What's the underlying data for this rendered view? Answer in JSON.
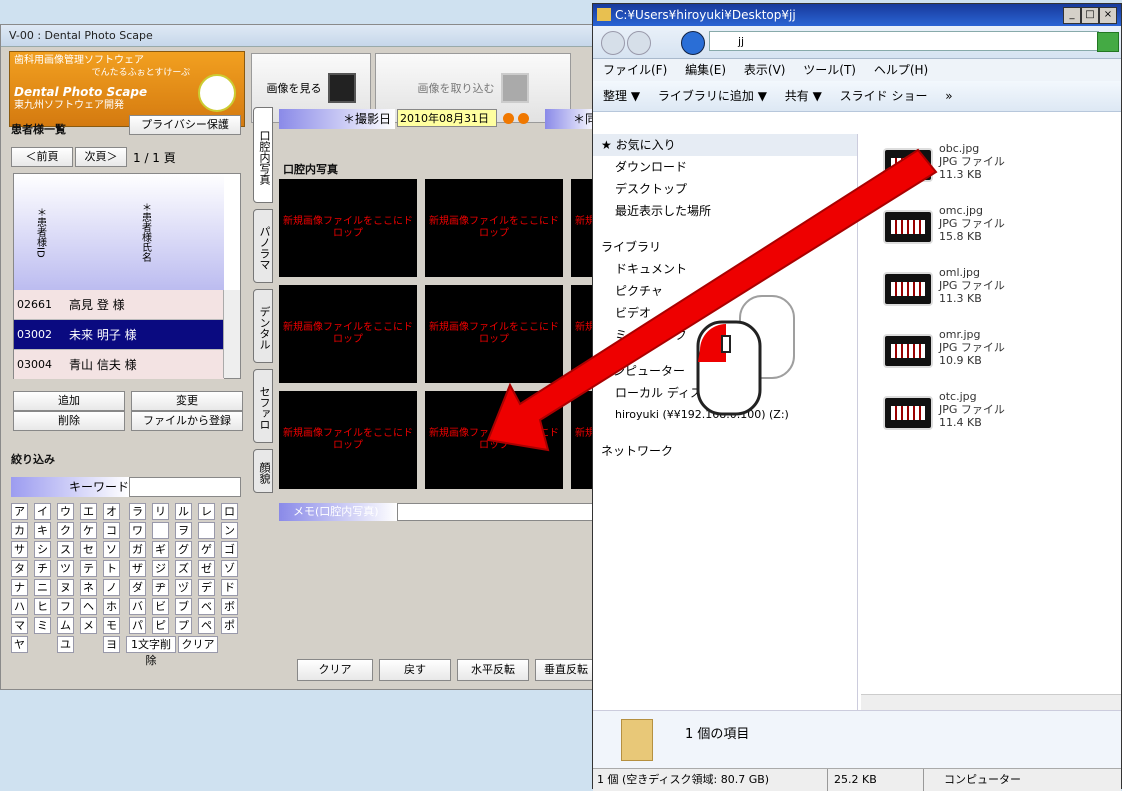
{
  "app": {
    "title": "V-00 : Dental Photo Scape",
    "logo": {
      "line1": "歯科用画像管理ソフトウェア",
      "line2": "でんたるふぉとすけーぷ",
      "brand": "Dental Photo Scape",
      "maker": "東九州ソフトウェア開発"
    },
    "toolbar": {
      "view": "画像を見る",
      "import": "画像を取り込む"
    },
    "patients": {
      "heading": "患者様一覧",
      "privacy": "プライバシー保護",
      "prev": "＜前頁",
      "next": "次頁＞",
      "page": "1 / 1 頁",
      "col_id": "＊患者様ID",
      "col_name": "＊患者様氏名",
      "rows": [
        {
          "id": "02661",
          "name": "高見 登 様"
        },
        {
          "id": "03002",
          "name": "未来 明子 様"
        },
        {
          "id": "03004",
          "name": "青山 信夫 様"
        }
      ],
      "add": "追加",
      "change": "変更",
      "delete": "削除",
      "from_file": "ファイルから登録"
    },
    "filter": {
      "heading": "絞り込み",
      "keyword_label": "キーワード",
      "kana": [
        "ア",
        "イ",
        "ウ",
        "エ",
        "オ",
        "ラ",
        "リ",
        "ル",
        "レ",
        "ロ",
        "カ",
        "キ",
        "ク",
        "ケ",
        "コ",
        "ワ",
        "",
        "ヲ",
        "",
        "ン",
        "サ",
        "シ",
        "ス",
        "セ",
        "ソ",
        "ガ",
        "ギ",
        "グ",
        "ゲ",
        "ゴ",
        "タ",
        "チ",
        "ツ",
        "テ",
        "ト",
        "ザ",
        "ジ",
        "ズ",
        "ゼ",
        "ゾ",
        "ナ",
        "ニ",
        "ヌ",
        "ネ",
        "ノ",
        "ダ",
        "ヂ",
        "ヅ",
        "デ",
        "ド",
        "ハ",
        "ヒ",
        "フ",
        "ヘ",
        "ホ",
        "バ",
        "ビ",
        "ブ",
        "ベ",
        "ボ",
        "マ",
        "ミ",
        "ム",
        "メ",
        "モ",
        "パ",
        "ピ",
        "プ",
        "ペ",
        "ポ"
      ],
      "ya": "ヤ",
      "yu": "ユ",
      "yo": "ヨ",
      "del1": "1文字削除",
      "clear": "クリア"
    },
    "tabs": [
      "口腔内写真",
      "パノラマ",
      "デンタル",
      "セファロ",
      "顔貌"
    ],
    "date_label": "＊撮影日",
    "date": "2010年08月31日",
    "date_label2": "＊同",
    "section": "口腔内写真",
    "drop_text": "新規画像ファイルをここにドロップ",
    "memo_label": "メモ(口腔内写真)",
    "bottom": {
      "clear": "クリア",
      "back": "戻す",
      "hflip": "水平反転",
      "vflip": "垂直反転"
    }
  },
  "explorer": {
    "title": "C:¥Users¥hiroyuki¥Desktop¥jj",
    "address": "jj",
    "menu": [
      "ファイル(F)",
      "編集(E)",
      "表示(V)",
      "ツール(T)",
      "ヘルプ(H)"
    ],
    "commands": [
      "整理 ▼",
      "ライブラリに追加 ▼",
      "共有 ▼",
      "スライド ショー",
      "»"
    ],
    "nav": [
      "お気に入り",
      "ダウンロード",
      "デスクトップ",
      "最近表示した場所",
      "ライブラリ",
      "ドキュメント",
      "ピクチャ",
      "ビデオ",
      "ミュージック",
      "コンピューター",
      "ローカル ディスク (C:)",
      "hiroyuki (¥¥192.168.0.100) (Z:)",
      "ネットワーク"
    ],
    "files": [
      {
        "name": "obc.jpg",
        "type": "JPG ファイル",
        "size": "11.3 KB"
      },
      {
        "name": "omc.jpg",
        "type": "JPG ファイル",
        "size": "15.8 KB"
      },
      {
        "name": "oml.jpg",
        "type": "JPG ファイル",
        "size": "11.3 KB"
      },
      {
        "name": "omr.jpg",
        "type": "JPG ファイル",
        "size": "10.9 KB"
      },
      {
        "name": "otc.jpg",
        "type": "JPG ファイル",
        "size": "11.4 KB"
      }
    ],
    "details": "1 個の項目",
    "status": {
      "free": "1 個 (空きディスク領域: 80.7 GB)",
      "size": "25.2 KB",
      "computer": "コンピューター"
    }
  }
}
